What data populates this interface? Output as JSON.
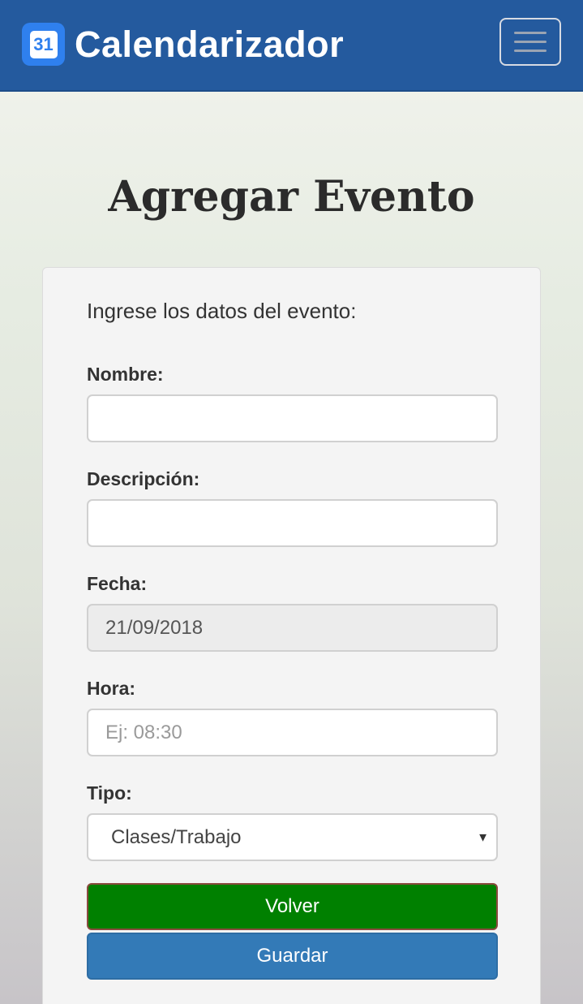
{
  "navbar": {
    "brand_title": "Calendarizador",
    "brand_icon": "calendar-31-icon",
    "menu_icon": "hamburger-menu-icon"
  },
  "page": {
    "title": "Agregar Evento"
  },
  "form": {
    "heading": "Ingrese los datos del evento:",
    "nombre": {
      "label": "Nombre:",
      "value": ""
    },
    "descripcion": {
      "label": "Descripción:",
      "value": ""
    },
    "fecha": {
      "label": "Fecha:",
      "value": "21/09/2018"
    },
    "hora": {
      "label": "Hora:",
      "value": "",
      "placeholder": "Ej: 08:30"
    },
    "tipo": {
      "label": "Tipo:",
      "selected": "Clases/Trabajo"
    },
    "volver_label": "Volver",
    "guardar_label": "Guardar"
  },
  "colors": {
    "navbar": "#245a9e",
    "volver": "#008000",
    "guardar": "#337ab7"
  }
}
